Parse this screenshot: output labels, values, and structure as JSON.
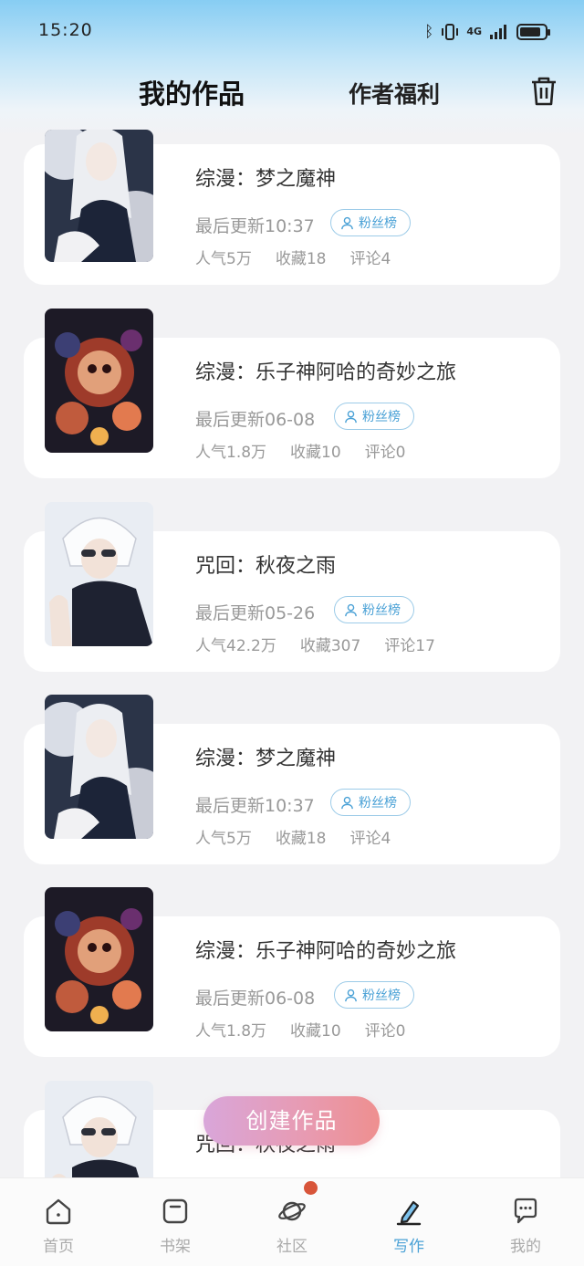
{
  "status_bar": {
    "time": "15:20",
    "network": "4G"
  },
  "header": {
    "tab_works": "我的作品",
    "tab_benefits": "作者福利"
  },
  "works": [
    {
      "title": "综漫：梦之魔神",
      "updated": "最后更新10:37",
      "fan_label": "粉丝榜",
      "popularity": "人气5万",
      "favorites": "收藏18",
      "comments": "评论4",
      "cover": "white-hair-girl"
    },
    {
      "title": "综漫：乐子神阿哈的奇妙之旅",
      "updated": "最后更新06-08",
      "fan_label": "粉丝榜",
      "popularity": "人气1.8万",
      "favorites": "收藏10",
      "comments": "评论0",
      "cover": "mask-jester"
    },
    {
      "title": "咒回：秋夜之雨",
      "updated": "最后更新05-26",
      "fan_label": "粉丝榜",
      "popularity": "人气42.2万",
      "favorites": "收藏307",
      "comments": "评论17",
      "cover": "white-hair-boy"
    },
    {
      "title": "综漫：梦之魔神",
      "updated": "最后更新10:37",
      "fan_label": "粉丝榜",
      "popularity": "人气5万",
      "favorites": "收藏18",
      "comments": "评论4",
      "cover": "white-hair-girl"
    },
    {
      "title": "综漫：乐子神阿哈的奇妙之旅",
      "updated": "最后更新06-08",
      "fan_label": "粉丝榜",
      "popularity": "人气1.8万",
      "favorites": "收藏10",
      "comments": "评论0",
      "cover": "mask-jester"
    },
    {
      "title": "咒回：秋夜之雨",
      "updated": "",
      "fan_label": "",
      "popularity": "",
      "favorites": "",
      "comments": "",
      "cover": "white-hair-boy"
    }
  ],
  "create_button": "创建作品",
  "tabs": [
    {
      "label": "首页",
      "icon": "home-icon"
    },
    {
      "label": "书架",
      "icon": "bookshelf-icon"
    },
    {
      "label": "社区",
      "icon": "planet-icon"
    },
    {
      "label": "写作",
      "icon": "pen-icon"
    },
    {
      "label": "我的",
      "icon": "chat-icon"
    }
  ],
  "colors": {
    "accent": "#4aa1d6",
    "badge_dot": "#d8553a",
    "button_start": "#d9a6da",
    "button_end": "#ee8f8f"
  }
}
